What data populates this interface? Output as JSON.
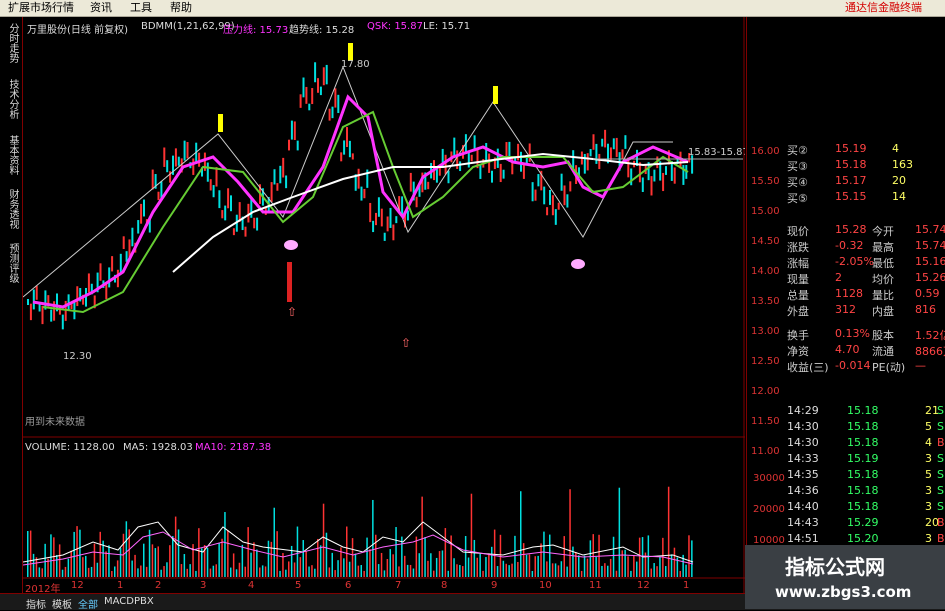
{
  "menu": {
    "items": [
      "扩展市场行情",
      "资讯",
      "工具",
      "帮助"
    ],
    "promo": "通达信金融终端"
  },
  "sidebar_tabs": [
    "分时走势",
    "技术分析",
    "基本资料",
    "财务透视",
    "预测评级"
  ],
  "chart_header": {
    "title": "万里股份(日线 前复权)",
    "indicator": "BDMM(1,21,62,99)",
    "pressure": "压力线: 15.73",
    "trend": "趋势线: 15.28",
    "qsk": "QSK: 15.87",
    "le": "LE: 15.71"
  },
  "annotations": {
    "high": "17.80",
    "low": "12.30",
    "right_range": "15.83-15.87",
    "no_future": "用到未来数据"
  },
  "volume_header": {
    "volume": "VOLUME: 1128.00",
    "ma5": "MA5: 1928.03",
    "ma10": "MA10: 2187.38"
  },
  "price_axis": [
    "16.00",
    "15.50",
    "15.00",
    "14.50",
    "14.00",
    "13.50",
    "13.00",
    "12.50",
    "12.00",
    "11.50",
    "11.00"
  ],
  "volume_axis": [
    "30000",
    "20000",
    "10000"
  ],
  "x_axis": [
    "2012年",
    "12",
    "1",
    "2",
    "3",
    "4",
    "5",
    "6",
    "7",
    "8",
    "9",
    "10",
    "11",
    "12",
    "1"
  ],
  "order_book": [
    {
      "label": "买②",
      "price": "15.19",
      "vol": "4"
    },
    {
      "label": "买③",
      "price": "15.18",
      "vol": "163"
    },
    {
      "label": "买④",
      "price": "15.17",
      "vol": "20"
    },
    {
      "label": "买⑤",
      "price": "15.15",
      "vol": "14"
    }
  ],
  "stats": [
    {
      "k1": "现价",
      "v1": "15.28",
      "k2": "今开",
      "v2": "15.74"
    },
    {
      "k1": "涨跌",
      "v1": "-0.32",
      "k2": "最高",
      "v2": "15.74"
    },
    {
      "k1": "涨幅",
      "v1": "-2.05%",
      "k2": "最低",
      "v2": "15.16"
    },
    {
      "k1": "现量",
      "v1": "2",
      "k2": "均价",
      "v2": "15.26"
    },
    {
      "k1": "总量",
      "v1": "1128",
      "k2": "量比",
      "v2": "0.59"
    },
    {
      "k1": "外盘",
      "v1": "312",
      "k2": "内盘",
      "v2": "816"
    }
  ],
  "fundamentals": [
    {
      "k1": "换手",
      "v1": "0.13%",
      "k2": "股本",
      "v2": "1.52亿"
    },
    {
      "k1": "净资",
      "v1": "4.70",
      "k2": "流通",
      "v2": "8866万"
    },
    {
      "k1": "收益(三)",
      "v1": "-0.014",
      "k2": "PE(动)",
      "v2": "—"
    }
  ],
  "ticks": [
    {
      "time": "14:29",
      "price": "15.18",
      "vol": "21",
      "flag": "S"
    },
    {
      "time": "14:30",
      "price": "15.18",
      "vol": "5",
      "flag": "S"
    },
    {
      "time": "14:30",
      "price": "15.18",
      "vol": "4",
      "flag": "B"
    },
    {
      "time": "14:33",
      "price": "15.19",
      "vol": "3",
      "flag": "S"
    },
    {
      "time": "14:35",
      "price": "15.18",
      "vol": "5",
      "flag": "S"
    },
    {
      "time": "14:36",
      "price": "15.18",
      "vol": "3",
      "flag": "S"
    },
    {
      "time": "14:40",
      "price": "15.18",
      "vol": "3",
      "flag": "S"
    },
    {
      "time": "14:43",
      "price": "15.29",
      "vol": "20",
      "flag": "B"
    },
    {
      "time": "14:51",
      "price": "15.20",
      "vol": "3",
      "flag": "B"
    },
    {
      "time": "14:52",
      "price": "15.20",
      "vol": "1",
      "flag": "B"
    },
    {
      "time": "14:54",
      "price": "15.20",
      "vol": "1",
      "flag": "S"
    }
  ],
  "bottom_tabs": [
    "指标",
    "模板",
    "全部",
    "MACD",
    "PBX"
  ],
  "watermark": {
    "title": "指标公式网",
    "url": "www.zbgs3.com"
  },
  "colors": {
    "up": "#ff3333",
    "down": "#00e0e0",
    "magenta": "#ff33ff",
    "green_line": "#66cc33",
    "white_line": "#ffffff",
    "axis_red": "#aa0000",
    "text_gray": "#cccccc",
    "yellow": "#ffff00"
  }
}
